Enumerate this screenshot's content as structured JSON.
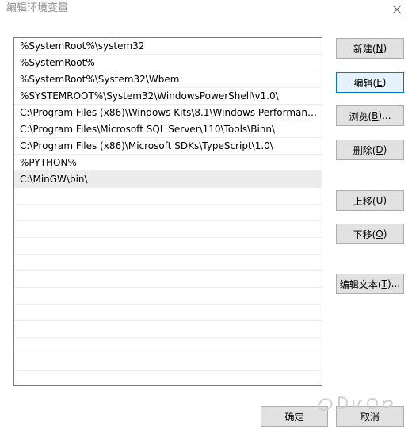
{
  "window": {
    "title": "编辑环境变量"
  },
  "path_list": {
    "items": [
      "%SystemRoot%\\system32",
      "%SystemRoot%",
      "%SystemRoot%\\System32\\Wbem",
      "%SYSTEMROOT%\\System32\\WindowsPowerShell\\v1.0\\",
      "C:\\Program Files (x86)\\Windows Kits\\8.1\\Windows Performance...",
      "C:\\Program Files\\Microsoft SQL Server\\110\\Tools\\Binn\\",
      "C:\\Program Files (x86)\\Microsoft SDKs\\TypeScript\\1.0\\",
      "%PYTHON%",
      "C:\\MinGW\\bin\\"
    ],
    "selected_index": 8
  },
  "buttons": {
    "new": {
      "label": "新建(",
      "key": "N",
      "tail": ")"
    },
    "edit": {
      "label": "编辑(",
      "key": "E",
      "tail": ")"
    },
    "browse": {
      "label": "浏览(",
      "key": "B",
      "tail": ")..."
    },
    "delete": {
      "label": "删除(",
      "key": "D",
      "tail": ")"
    },
    "move_up": {
      "label": "上移(",
      "key": "U",
      "tail": ")"
    },
    "move_down": {
      "label": "下移(",
      "key": "O",
      "tail": ")"
    },
    "edit_text": {
      "label": "编辑文本(",
      "key": "T",
      "tail": ")..."
    },
    "ok": {
      "label": "确定"
    },
    "cancel": {
      "label": "取消"
    }
  },
  "colors": {
    "focus_border": "#0078d7",
    "selected_row": "#ececec"
  },
  "icons": {
    "close": "close-icon"
  }
}
